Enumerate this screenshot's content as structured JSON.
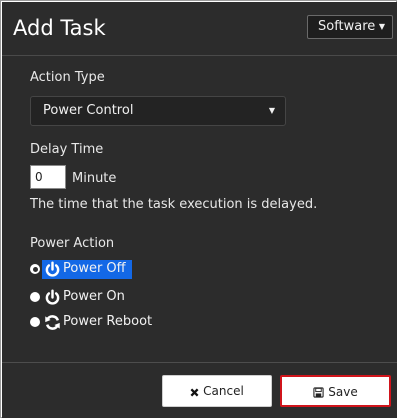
{
  "dialog": {
    "title": "Add Task",
    "category_select": "Software"
  },
  "form": {
    "action_type_label": "Action Type",
    "action_type_value": "Power Control",
    "delay_label": "Delay Time",
    "delay_value": "0",
    "delay_unit": "Minute",
    "delay_help": "The time that the task execution is delayed.",
    "power_action_label": "Power Action",
    "power_options": [
      {
        "label": "Power Off",
        "icon": "power-icon",
        "selected": true
      },
      {
        "label": "Power On",
        "icon": "power-icon",
        "selected": false
      },
      {
        "label": "Power Reboot",
        "icon": "refresh-icon",
        "selected": false
      }
    ]
  },
  "footer": {
    "cancel_label": "Cancel",
    "save_label": "Save"
  },
  "colors": {
    "panel_background": "#2c2c2c",
    "selection_highlight": "#1368e6",
    "save_border": "#d0141b"
  }
}
